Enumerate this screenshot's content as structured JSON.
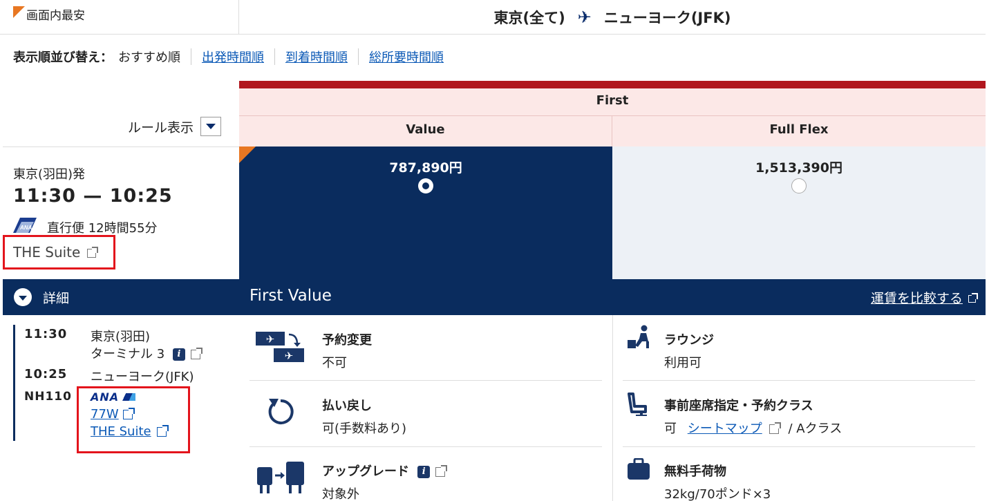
{
  "header": {
    "best_label": "画面内最安",
    "origin": "東京(全て)",
    "destination": "ニューヨーク(JFK)"
  },
  "sort": {
    "label": "表示順並び替え：",
    "options": [
      "おすすめ順",
      "出発時間順",
      "到着時間順",
      "総所要時間順"
    ]
  },
  "fare_table": {
    "cabin": "First",
    "columns": [
      "Value",
      "Full Flex"
    ],
    "prices": [
      "787,890円",
      "1,513,390円"
    ],
    "selected": "Value"
  },
  "rules": {
    "label": "ルール表示"
  },
  "flight": {
    "departure_label": "東京(羽田)発",
    "times": "11:30 — 10:25",
    "duration": "直行便 12時間55分",
    "seat_product": "THE Suite"
  },
  "details": {
    "toggle_label": "詳細",
    "fare_title": "First Value",
    "compare_link": "運賃を比較する",
    "dep_time": "11:30",
    "dep_airport": "東京(羽田)",
    "dep_terminal": "ターミナル 3",
    "arr_time": "10:25",
    "arr_airport": "ニューヨーク(JFK)",
    "flight_no": "NH110",
    "airline_logo": "ANA",
    "aircraft": "77W",
    "seat_product": "THE Suite"
  },
  "features": {
    "change": {
      "title": "予約変更",
      "value": "不可",
      "icon": "change-flight-icon"
    },
    "refund": {
      "title": "払い戻し",
      "value": "可(手数料あり)",
      "icon": "refund-icon"
    },
    "upgrade": {
      "title": "アップグレード",
      "value": "対象外",
      "icon": "upgrade-icon"
    },
    "lounge": {
      "title": "ラウンジ",
      "value": "利用可",
      "icon": "lounge-icon"
    },
    "seat": {
      "title": "事前座席指定・予約クラス",
      "value_prefix": "可",
      "seatmap_link": "シートマップ",
      "value_suffix": "/ Aクラス",
      "icon": "seat-icon"
    },
    "baggage": {
      "title": "無料手荷物",
      "value": "32kg/70ポンド×3",
      "icon": "baggage-icon"
    }
  },
  "colors": {
    "navy": "#0a2c5e",
    "red_bar": "#b1171e",
    "pink_header": "#fce8e7",
    "orange": "#e87722",
    "link": "#0b59b6",
    "highlight_box": "#e3141c"
  }
}
